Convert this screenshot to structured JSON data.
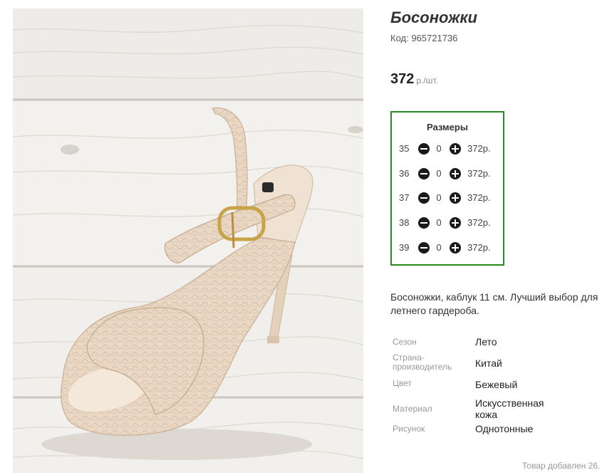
{
  "product": {
    "title": "Босоножки",
    "code_label": "Код:",
    "code": "965721736",
    "price": "372",
    "price_unit": "р./шт."
  },
  "sizes": {
    "title": "Размеры",
    "rows": [
      {
        "size": "35",
        "qty": "0",
        "price": "372р."
      },
      {
        "size": "36",
        "qty": "0",
        "price": "372р."
      },
      {
        "size": "37",
        "qty": "0",
        "price": "372р."
      },
      {
        "size": "38",
        "qty": "0",
        "price": "372р."
      },
      {
        "size": "39",
        "qty": "0",
        "price": "372р."
      }
    ]
  },
  "description": "Босоножки, каблук 11 см. Лучший выбор для летнего гардероба.",
  "attributes": [
    {
      "name": "Сезон",
      "value": "Лето"
    },
    {
      "name": "Страна-производитель",
      "value": "Китай"
    },
    {
      "name": "Цвет",
      "value": "Бежевый"
    },
    {
      "name": "Материал",
      "value": "Искусственная кожа"
    },
    {
      "name": "Рисунок",
      "value": "Однотонные"
    }
  ],
  "added_text": "Товар добавлен 26.",
  "colors": {
    "sizes_border": "#2a8a1f",
    "shoe": "#e9d7c3",
    "background_wood": "#f1efec"
  },
  "icons": {
    "decrease": "minus-circle-icon",
    "increase": "plus-circle-icon"
  }
}
